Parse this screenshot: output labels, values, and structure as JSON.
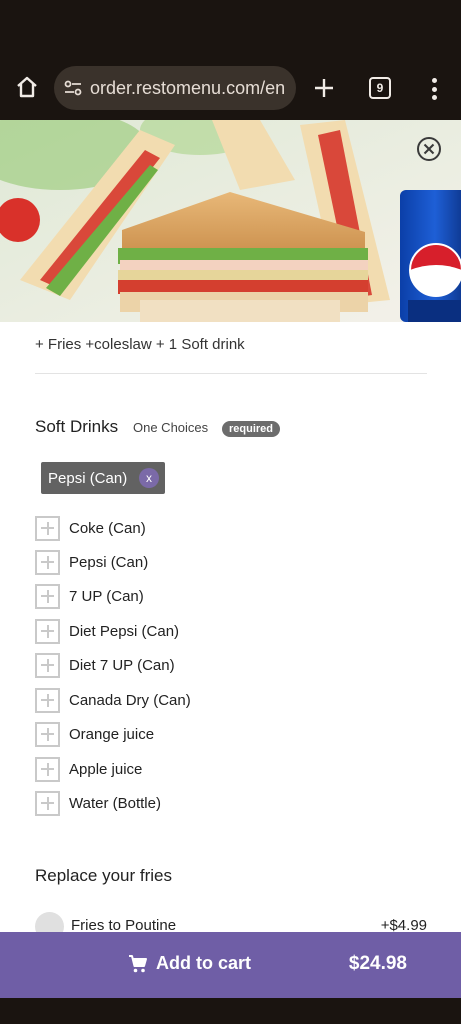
{
  "browser": {
    "url": "order.restomenu.com/en",
    "tab_count": "9",
    "icons": [
      "home-icon",
      "site-settings-icon",
      "plus-icon",
      "tabs-icon",
      "overflow-menu-icon"
    ]
  },
  "item": {
    "description": "+ Fries +coleslaw + 1 Soft drink",
    "hero_image": "club-sandwich-with-pepsi-can"
  },
  "soft_drinks": {
    "title": "Soft Drinks",
    "choices_label": "One Choices",
    "required_badge": "required",
    "selected": {
      "label": "Pepsi (Can)",
      "remove_label": "x"
    },
    "options": [
      "Coke (Can)",
      "Pepsi (Can)",
      "7 UP (Can)",
      "Diet Pepsi (Can)",
      "Diet 7 UP (Can)",
      "Canada Dry (Can)",
      "Orange juice",
      "Apple juice",
      "Water (Bottle)"
    ]
  },
  "fries": {
    "title": "Replace your fries",
    "options": [
      {
        "label": "Fries to Poutine",
        "price": "+$4.99"
      }
    ]
  },
  "cart": {
    "label": "Add to cart",
    "total": "$24.98"
  },
  "colors": {
    "accent": "#6f5ea6",
    "chip": "#626262",
    "browser_bg": "#1a1410"
  }
}
